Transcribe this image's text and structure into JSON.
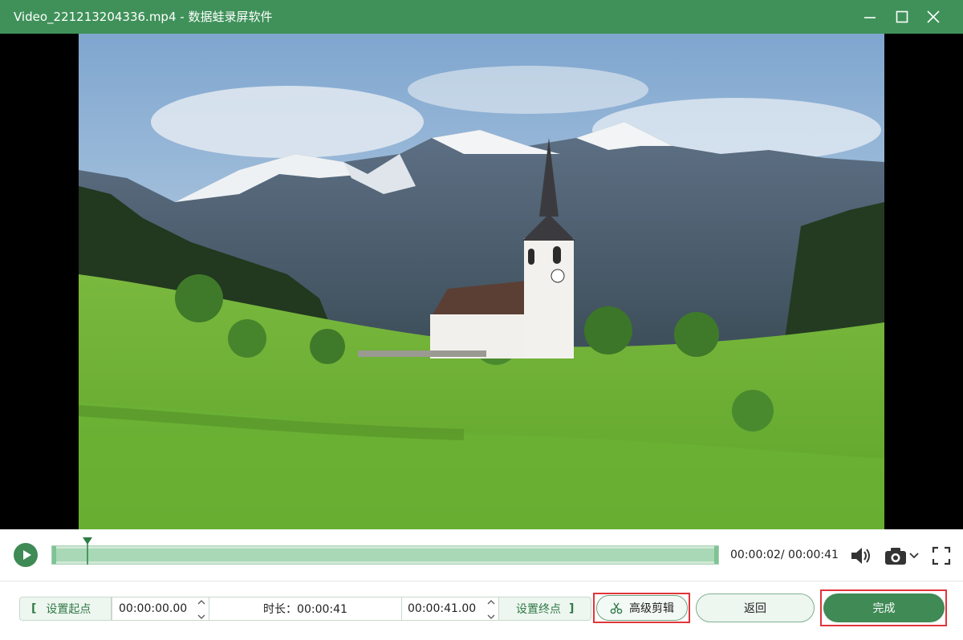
{
  "window": {
    "title": "Video_221213204336.mp4  -  数据蛙录屏软件",
    "minimize_icon": "minimize-icon",
    "maximize_icon": "maximize-icon",
    "close_icon": "close-icon",
    "accent_color": "#3f9159"
  },
  "player": {
    "time_readout": "00:00:02/ 00:00:41",
    "progress_fraction": 0.05,
    "play_icon": "play-icon",
    "volume_icon": "volume-icon",
    "camera_icon": "camera-icon",
    "fullscreen_icon": "fullscreen-icon"
  },
  "trim": {
    "set_start_label": "设置起点",
    "start_time": "00:00:00.00",
    "duration_text": "时长：00:00:41",
    "end_time": "00:00:41.00",
    "set_end_label": "设置终点"
  },
  "actions": {
    "advanced_edit_label": "高级剪辑",
    "advanced_edit_icon": "scissors-icon",
    "back_label": "返回",
    "done_label": "完成"
  }
}
